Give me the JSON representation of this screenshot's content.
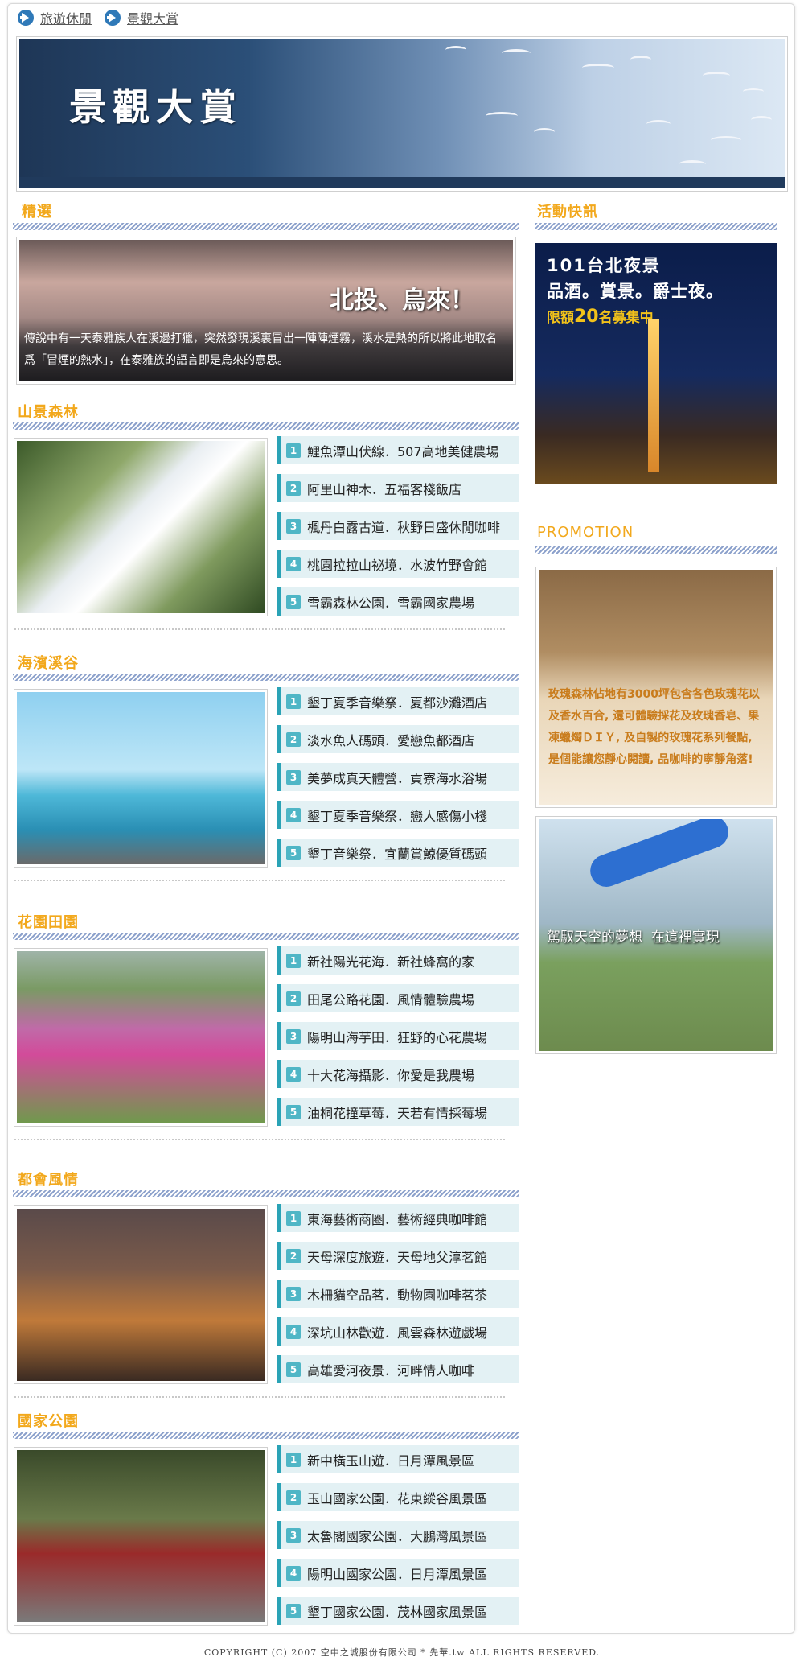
{
  "breadcrumb": {
    "items": [
      "旅遊休閒",
      "景觀大賞"
    ]
  },
  "banner": {
    "title": "景觀大賞"
  },
  "featured": {
    "title": "精選",
    "promo_title": "北投、烏來！",
    "promo_text": "傳說中有一天泰雅族人在溪邊打獵，突然發現溪裏冒出一陣陣煙霧，溪水是熱的所以將此地取名爲「冒煙的熱水」，在泰雅族的語言即是烏來的意思。"
  },
  "sections": [
    {
      "title": "山景森林",
      "items": [
        "鯉魚潭山伏線．507高地美健農場",
        "阿里山神木．五福客棧飯店",
        "楓丹白露古道．秋野日盛休閒咖啡",
        "桃園拉拉山祕境．水波竹野會館",
        "雪霸森林公園．雪霸國家農場"
      ]
    },
    {
      "title": "海濱溪谷",
      "items": [
        "墾丁夏季音樂祭．夏都沙灘酒店",
        "淡水魚人碼頭．愛戀魚都酒店",
        "美夢成真天體營．貢寮海水浴場",
        "墾丁夏季音樂祭．戀人感傷小棧",
        "墾丁音樂祭．宜蘭賞鯨優質碼頭"
      ]
    },
    {
      "title": "花園田園",
      "items": [
        "新社陽光花海．新社蜂窩的家",
        "田尾公路花園．風情體驗農場",
        "陽明山海芋田．狂野的心花農場",
        "十大花海攝影．你愛是我農場",
        "油桐花撞草莓．天若有情採莓場"
      ]
    },
    {
      "title": "都會風情",
      "items": [
        "東海藝術商圈．藝術經典咖啡館",
        "天母深度旅遊．天母地父淳茗館",
        "木柵貓空品茗．動物園咖啡茗茶",
        "深坑山林歡遊．風雲森林遊戲場",
        "高雄愛河夜景．河畔情人咖啡"
      ]
    },
    {
      "title": "國家公園",
      "items": [
        "新中橫玉山遊．日月潭風景區",
        "玉山國家公園．花東縱谷風景區",
        "太魯閣國家公園．大鵬灣風景區",
        "陽明山國家公園．日月潭風景區",
        "墾丁國家公園．茂林國家風景區"
      ]
    }
  ],
  "news": {
    "title": "活動快訊",
    "line1": "101台北夜景",
    "line2": "品酒。賞景。爵士夜。",
    "line3_pre": "限額",
    "line3_num": "20",
    "line3_post": "名募集中"
  },
  "promotion": {
    "title": "PROMOTION",
    "rose_text": "玫瑰森林佔地有3000坪包含各色玫瑰花以及香水百合, 還可體驗採花及玫瑰香皂、果凍蠟燭ＤＩＹ, 及自製的玫瑰花系列餐點, 是個能讓您靜心閱讀, 品咖啡的寧靜角落!",
    "plane_text": "駕馭天空的夢想  在這裡實現"
  },
  "footer": {
    "copyright": "COPYRIGHT (C) 2007 空中之城股份有限公司 * 先華.tw ALL RIGHTS RESERVED."
  },
  "colors": {
    "accent": "#f2a81c",
    "teal": "#2aa3b6",
    "item_bg": "#e3f1f4",
    "stripe": "#8da2cc"
  }
}
